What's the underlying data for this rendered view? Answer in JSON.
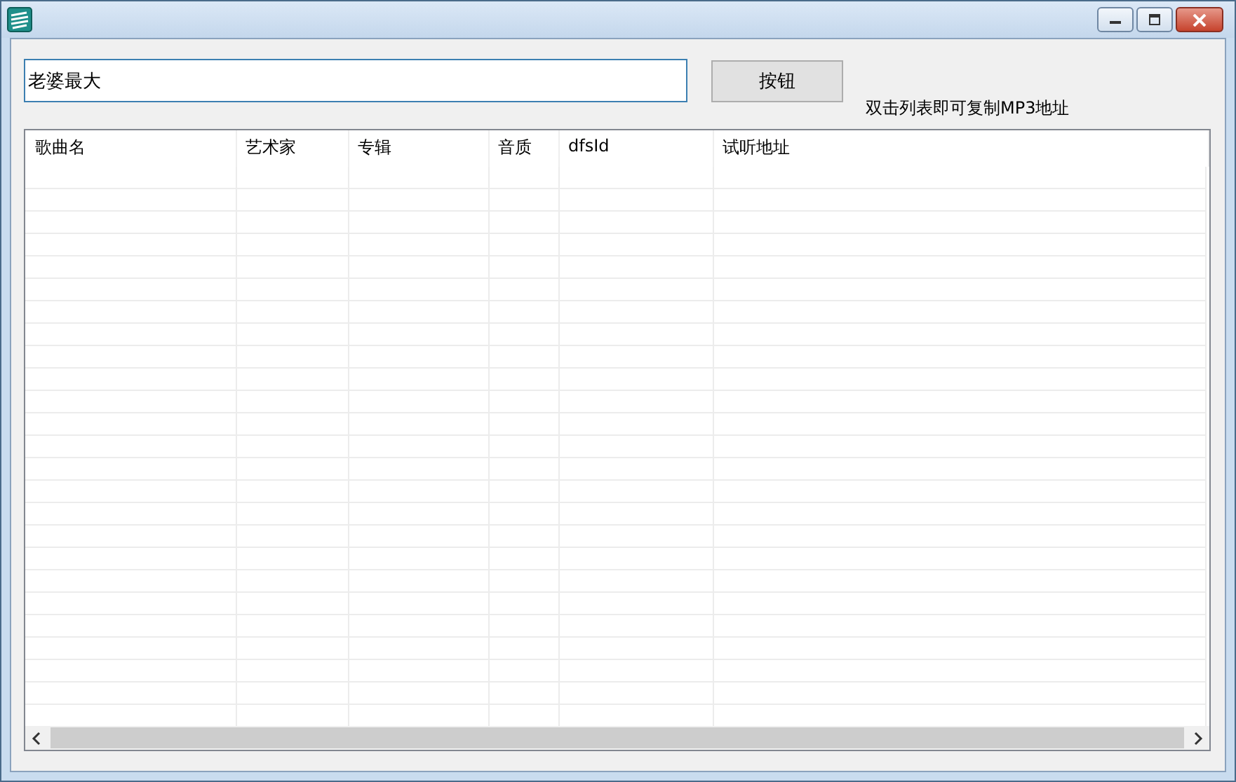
{
  "search": {
    "value": "老婆最大"
  },
  "button": "按钮",
  "hint": "双击列表即可复制MP3地址",
  "table": {
    "columns": [
      {
        "label": "歌曲名"
      },
      {
        "label": "艺术家"
      },
      {
        "label": "专辑"
      },
      {
        "label": "音质"
      },
      {
        "label": "dfsId"
      },
      {
        "label": "试听地址"
      }
    ]
  }
}
